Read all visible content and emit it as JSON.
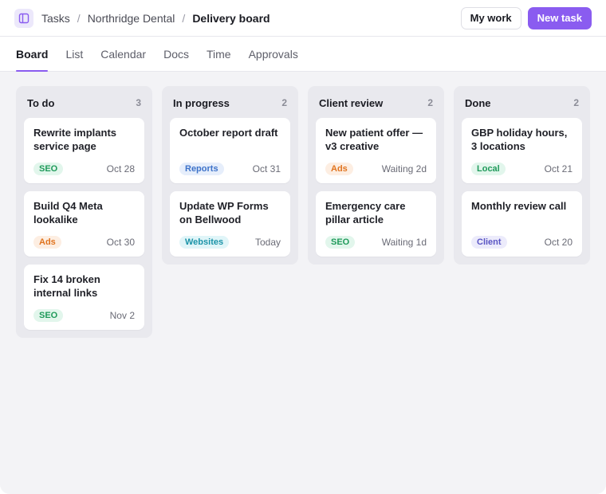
{
  "header": {
    "app_icon": "board-icon",
    "breadcrumb": [
      "Tasks",
      "Northridge Dental",
      "Delivery board"
    ],
    "separator": "/",
    "my_work_label": "My work",
    "new_task_label": "New task"
  },
  "tabs": [
    {
      "label": "Board",
      "active": true
    },
    {
      "label": "List",
      "active": false
    },
    {
      "label": "Calendar",
      "active": false
    },
    {
      "label": "Docs",
      "active": false
    },
    {
      "label": "Time",
      "active": false
    },
    {
      "label": "Approvals",
      "active": false
    }
  ],
  "columns": [
    {
      "title": "To do",
      "count": "3",
      "cards": [
        {
          "title": "Rewrite implants service page",
          "tag": "SEO",
          "meta": "Oct 28"
        },
        {
          "title": "Build Q4 Meta lookalike",
          "tag": "Ads",
          "meta": "Oct 30"
        },
        {
          "title": "Fix 14 broken internal links",
          "tag": "SEO",
          "meta": "Nov 2"
        }
      ]
    },
    {
      "title": "In progress",
      "count": "2",
      "cards": [
        {
          "title": "October report draft",
          "tag": "Reports",
          "meta": "Oct 31"
        },
        {
          "title": "Update WP Forms on Bellwood",
          "tag": "Websites",
          "meta": "Today"
        }
      ]
    },
    {
      "title": "Client review",
      "count": "2",
      "cards": [
        {
          "title": "New patient offer — v3 creative",
          "tag": "Ads",
          "meta": "Waiting 2d"
        },
        {
          "title": "Emergency care pillar article",
          "tag": "SEO",
          "meta": "Waiting 1d"
        }
      ]
    },
    {
      "title": "Done",
      "count": "2",
      "cards": [
        {
          "title": "GBP holiday hours, 3 locations",
          "tag": "Local",
          "meta": "Oct 21"
        },
        {
          "title": "Monthly review call",
          "tag": "Client",
          "meta": "Oct 20"
        }
      ]
    }
  ],
  "colors": {
    "accent": "#8a5cf0",
    "board_bg": "#f3f3f6",
    "column_bg": "#e9e9ee"
  }
}
